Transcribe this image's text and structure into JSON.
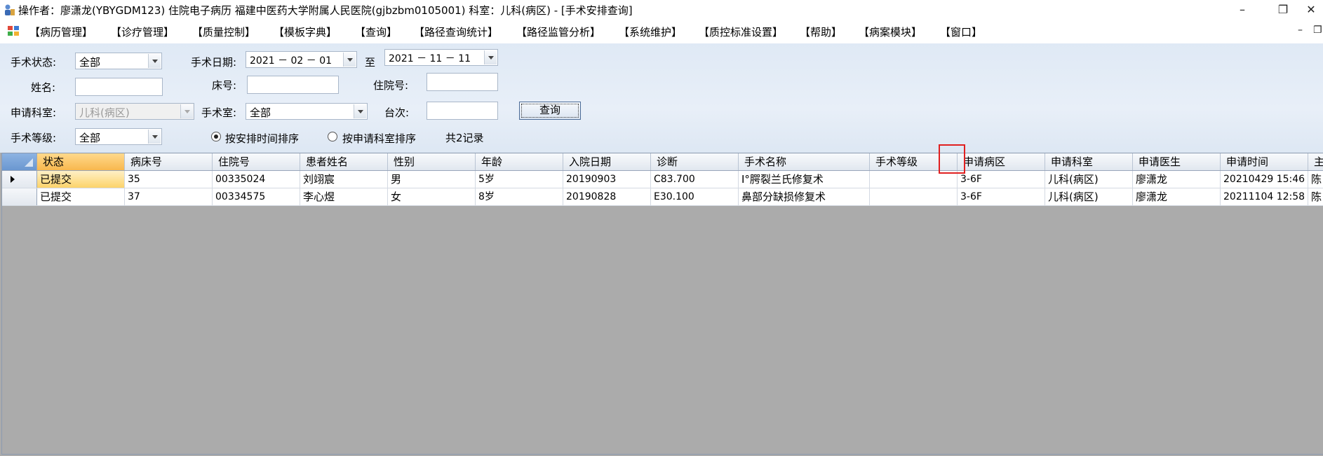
{
  "window": {
    "title": "操作者：廖潇龙(YBYGDM123) 住院电子病历  福建中医药大学附属人民医院(gjbzbm0105001)  科室：儿科(病区) - [手术安排查询]",
    "controls": [
      "–",
      "❐",
      "✕"
    ]
  },
  "menu": {
    "items": [
      "【病历管理】",
      "【诊疗管理】",
      "【质量控制】",
      "【模板字典】",
      "【查询】",
      "【路径查询统计】",
      "【路径监管分析】",
      "【系统维护】",
      "【质控标准设置】",
      "【帮助】",
      "【病案模块】",
      "【窗口】"
    ],
    "mdi_controls": [
      "–",
      "❐"
    ]
  },
  "filter": {
    "status_label": "手术状态:",
    "status_value": "全部",
    "date_label": "手术日期:",
    "date_from": "2021 － 02 － 01",
    "date_to_label": "至",
    "date_to": "2021 － 11 － 11",
    "name_label": "姓名:",
    "name_value": "",
    "bed_label": "床号:",
    "bed_value": "",
    "inpatient_label": "住院号:",
    "inpatient_value": "",
    "dept_label": "申请科室:",
    "dept_value": "儿科(病区)",
    "room_label": "手术室:",
    "room_value": "全部",
    "table_label": "台次:",
    "table_value": "",
    "query_button": "查询",
    "level_label": "手术等级:",
    "level_value": "全部",
    "sort_by_time": "按安排时间排序",
    "sort_by_dept": "按申请科室排序",
    "sort_selected": "time",
    "record_count": "共2记录"
  },
  "grid": {
    "columns": [
      "状态",
      "病床号",
      "住院号",
      "患者姓名",
      "性别",
      "年龄",
      "入院日期",
      "诊断",
      "手术名称",
      "手术等级",
      "申请病区",
      "申请科室",
      "申请医生",
      "申请时间",
      "主"
    ],
    "rows": [
      [
        "已提交",
        "35",
        "00335024",
        "刘翊宸",
        "男",
        "5岁",
        "20190903",
        "C83.700",
        "Ⅰ°腭裂兰氏修复术",
        "",
        "3-6F",
        "儿科(病区)",
        "廖潇龙",
        "20210429 15:46",
        "陈"
      ],
      [
        "已提交",
        "37",
        "00334575",
        "李心煜",
        "女",
        "8岁",
        "20190828",
        "E30.100",
        "鼻部分缺损修复术",
        "",
        "3-6F",
        "儿科(病区)",
        "廖潇龙",
        "20211104 12:58",
        "陈"
      ]
    ],
    "current_row": 0
  }
}
